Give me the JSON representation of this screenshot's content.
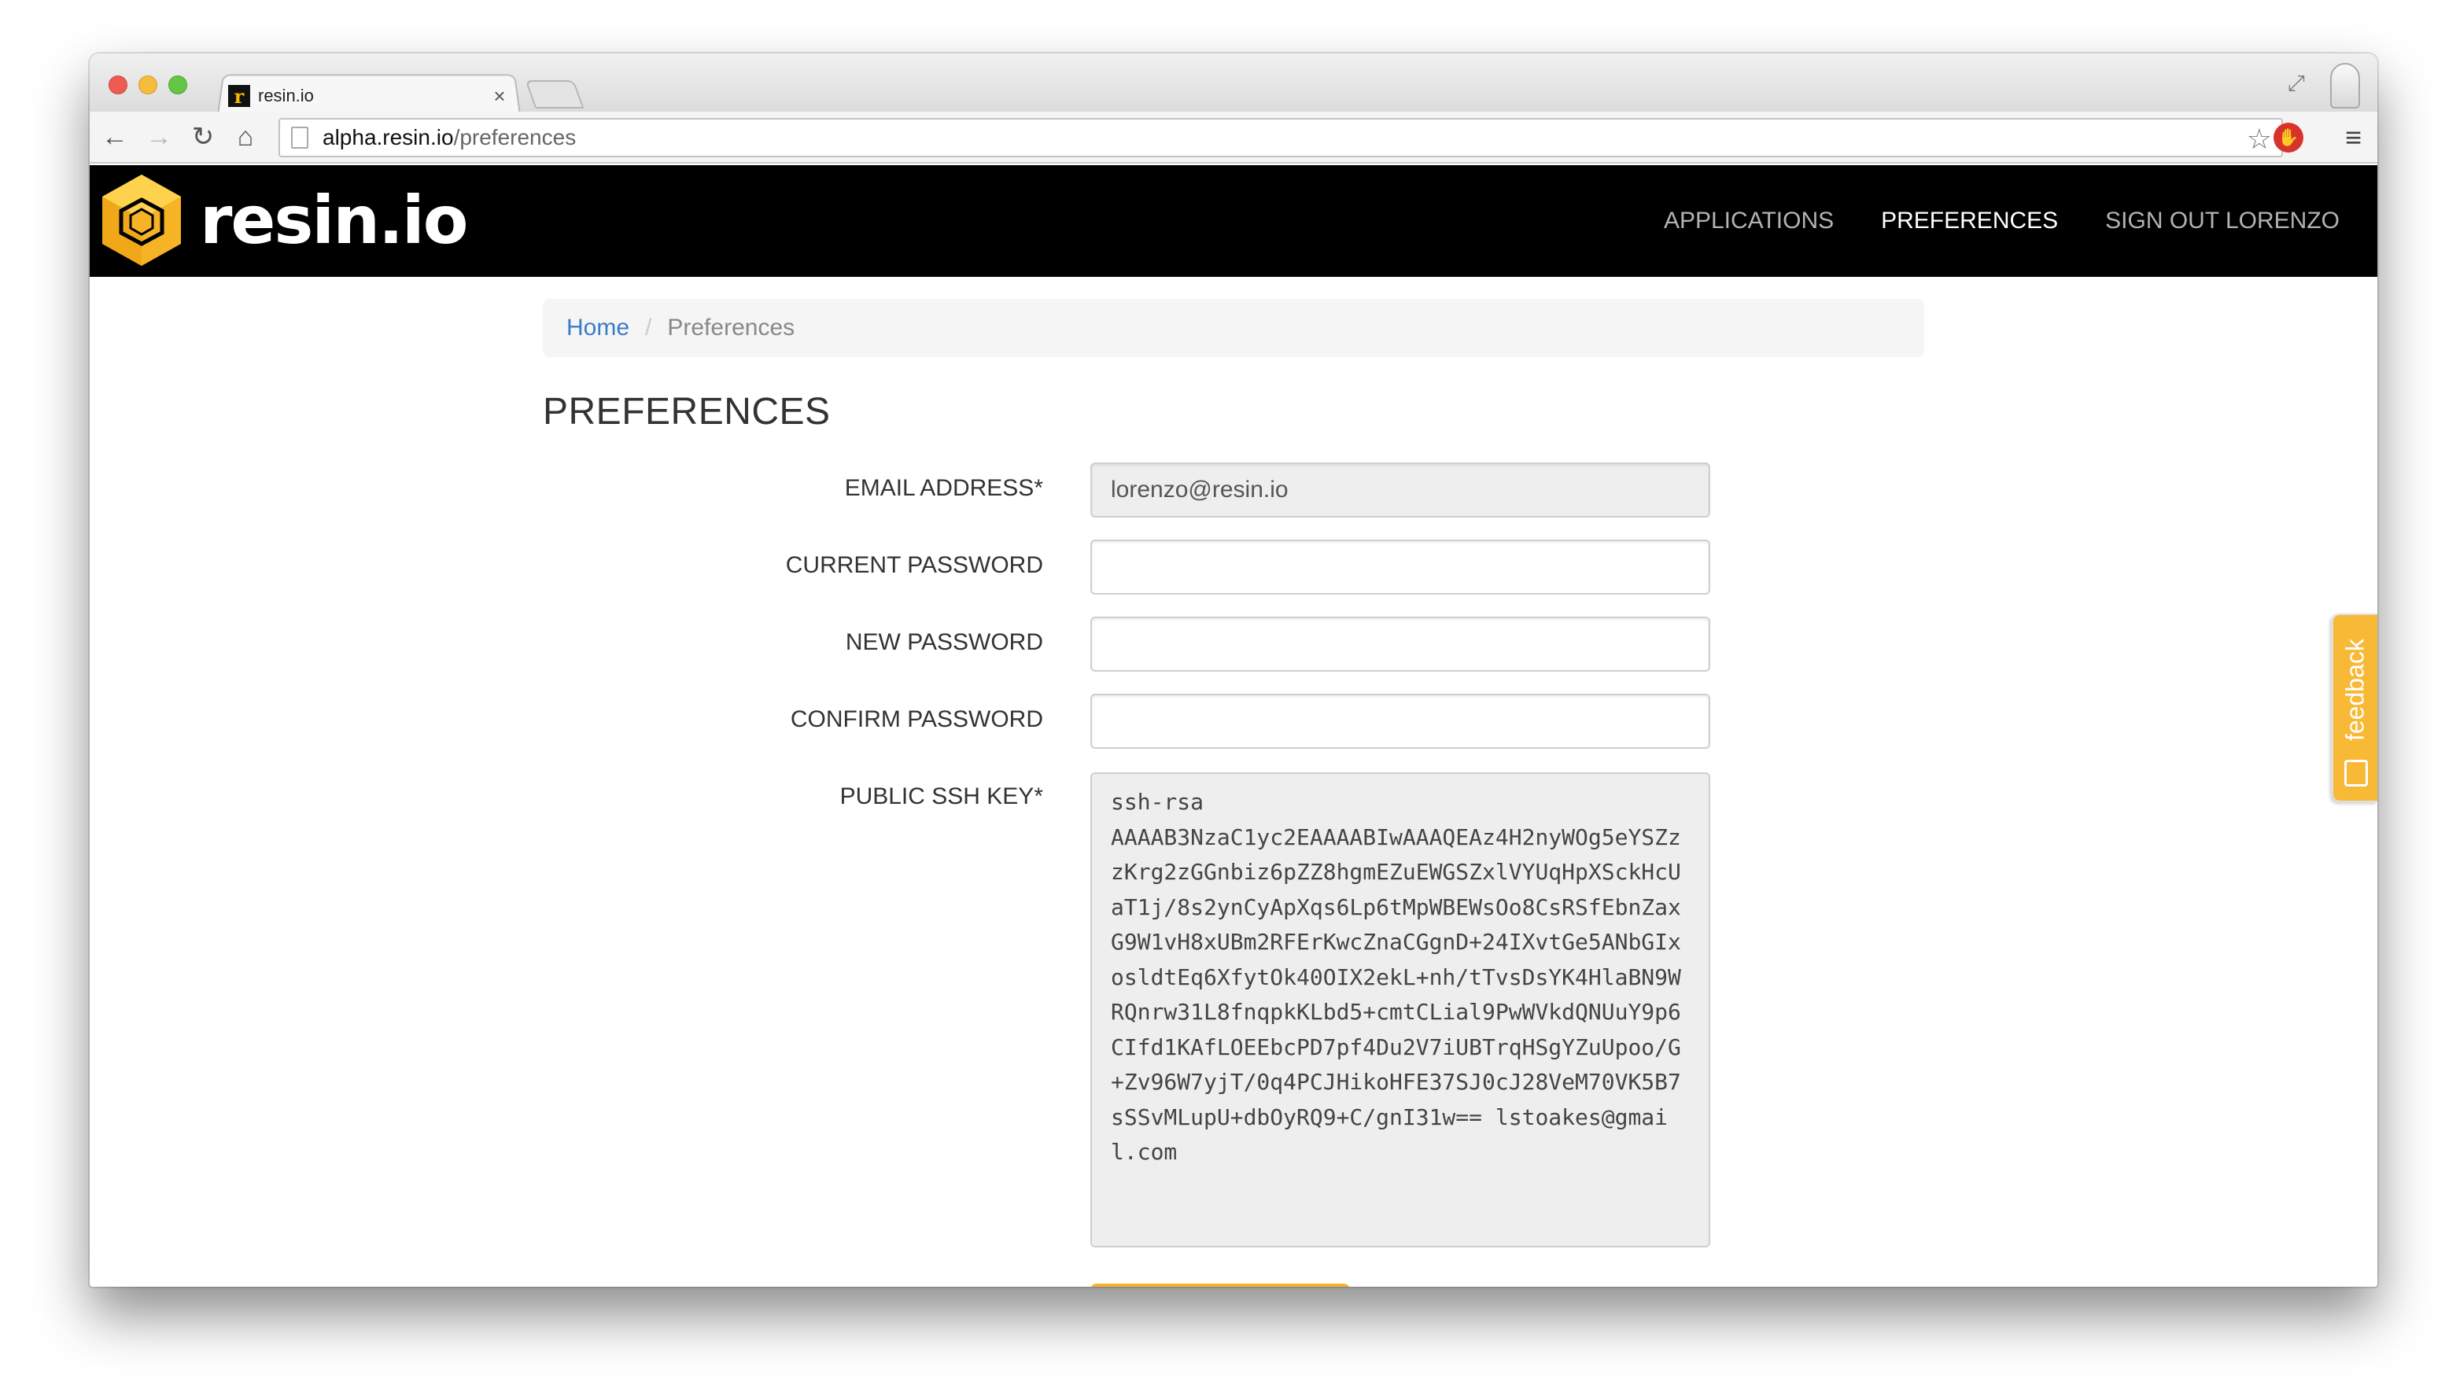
{
  "browser": {
    "tab_title": "resin.io",
    "tab_close": "×",
    "url_host": "alpha.resin.io",
    "url_path": "/preferences",
    "favicon_letter": "r",
    "icons": {
      "back": "arrow-left-icon",
      "forward": "arrow-right-icon",
      "reload": "reload-icon",
      "home": "home-icon",
      "bookmark": "star-icon",
      "extension": "stop-hand-icon",
      "menu": "hamburger-menu-icon",
      "resize": "fullscreen-icon"
    }
  },
  "navbar": {
    "brand": "resin.io",
    "links": [
      {
        "label": "APPLICATIONS",
        "active": false
      },
      {
        "label": "PREFERENCES",
        "active": true
      },
      {
        "label": "SIGN OUT LORENZO",
        "active": false
      }
    ]
  },
  "breadcrumb": {
    "home": "Home",
    "separator": "/",
    "current": "Preferences"
  },
  "page": {
    "title": "PREFERENCES"
  },
  "form": {
    "email": {
      "label": "EMAIL ADDRESS*",
      "value": "lorenzo@resin.io"
    },
    "current_password": {
      "label": "CURRENT PASSWORD",
      "value": ""
    },
    "new_password": {
      "label": "NEW PASSWORD",
      "value": ""
    },
    "confirm_password": {
      "label": "CONFIRM PASSWORD",
      "value": ""
    },
    "ssh_key": {
      "label": "PUBLIC SSH KEY*",
      "value": "ssh-rsa\nAAAAB3NzaC1yc2EAAAABIwAAAQEAz4H2nyWOg5eYSZzzKrg2zGGnbiz6pZZ8hgmEZuEWGSZxlVYUqHpXSckHcUaT1j/8s2ynCyApXqs6Lp6tMpWBEWsOo8CsRSfEbnZaxG9W1vH8xUBm2RFErKwcZnaCGgnD+24IXvtGe5ANbGIxosldtEq6XfytOk40OIX2ekL+nh/tTvsDsYK4HlaBN9WRQnrw31L8fnqpkKLbd5+cmtCLial9PwWVkdQNUuY9p6CIfd1KAfLOEEbcPD7pf4Du2V7iUBTrqHSgYZuUpoo/G+Zv96W7yjT/0q4PCJHikoHFE37SJ0cJ28VeM70VK5B7sSSvMLupU+dbOyRQ9+C/gnI31w== lstoakes@gmail.com"
    }
  },
  "feedback": {
    "label": "feedback"
  },
  "colors": {
    "navbar_bg": "#000000",
    "brand_accent": "#f5b325",
    "link_blue": "#3a7bc8"
  }
}
